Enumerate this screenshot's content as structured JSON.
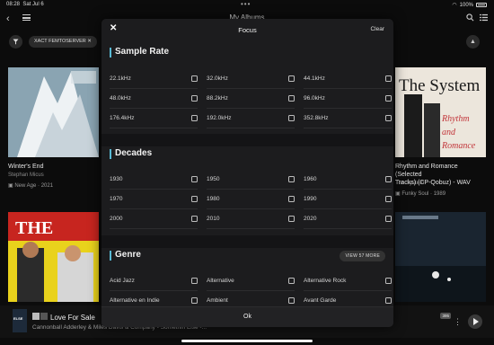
{
  "status_bar": {
    "time": "08:28",
    "date": "Sat Jul 6",
    "battery": "100%"
  },
  "header": {
    "title": "My Albums"
  },
  "filter": {
    "chip_label": "XACT FEMTOSERVER ✕"
  },
  "albums": [
    {
      "title": "Winter's End",
      "artist": "Stephan Micus",
      "genre": "New Age · 2021"
    },
    {
      "title": "Rhythm and Romance (Selected",
      "title2": "Tracks) (CP-Qobuz) - WAV",
      "artist": "The System",
      "genre": "Funky Soul · 1989"
    }
  ],
  "now_playing": {
    "title": "Love For Sale",
    "subtitle": "Cannonball Adderley & Miles Davis & Company - Somethin Else -...",
    "queue_count": "395"
  },
  "modal": {
    "title": "Focus",
    "close_glyph": "✕",
    "clear_label": "Clear",
    "ok_label": "Ok",
    "sections": {
      "sample_rate": {
        "title": "Sample Rate",
        "options": [
          "22.1kHz",
          "32.0kHz",
          "44.1kHz",
          "48.0kHz",
          "88.2kHz",
          "96.0kHz",
          "176.4kHz",
          "192.0kHz",
          "352.8kHz"
        ]
      },
      "decades": {
        "title": "Decades",
        "options": [
          "1930",
          "1950",
          "1960",
          "1970",
          "1980",
          "1990",
          "2000",
          "2010",
          "2020"
        ]
      },
      "genre": {
        "title": "Genre",
        "view_more": "VIEW 57 MORE",
        "options": [
          "Acid Jazz",
          "Alternative",
          "Alternative Rock",
          "Alternative en Indie",
          "Ambient",
          "Avant Garde"
        ]
      }
    }
  },
  "colors": {
    "accent": "#58b9d4",
    "modal_bg": "#1c1c1e"
  }
}
